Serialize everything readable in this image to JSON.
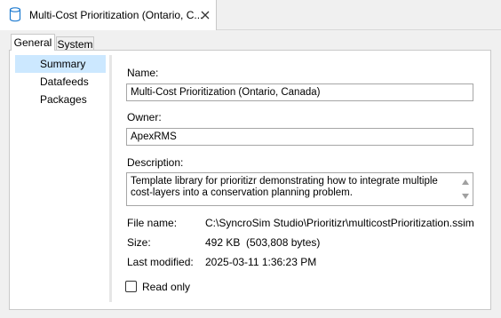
{
  "document_tab": {
    "title": "Multi-Cost Prioritization (Ontario, C...",
    "icon": "database-icon",
    "close_icon": "close-icon"
  },
  "tabs": [
    {
      "label": "General",
      "active": true
    },
    {
      "label": "System",
      "active": false
    }
  ],
  "nav": {
    "items": [
      {
        "label": "Summary",
        "selected": true
      },
      {
        "label": "Datafeeds",
        "selected": false
      },
      {
        "label": "Packages",
        "selected": false
      }
    ]
  },
  "form": {
    "name_label": "Name:",
    "name_value": "Multi-Cost Prioritization (Ontario, Canada)",
    "owner_label": "Owner:",
    "owner_value": "ApexRMS",
    "description_label": "Description:",
    "description_value": "Template library for prioritizr demonstrating how to integrate multiple cost-layers into a conservation planning problem."
  },
  "info": {
    "file_name_label": "File name:",
    "file_name_value": "C:\\SyncroSim Studio\\Prioritizr\\multicostPrioritization.ssim",
    "size_label": "Size:",
    "size_value": "492 KB  (503,808 bytes)",
    "modified_label": "Last modified:",
    "modified_value": "2025-03-11 1:36:23 PM"
  },
  "read_only": {
    "label": "Read only",
    "checked": false
  },
  "colors": {
    "selection": "#cce8ff",
    "panel_border": "#c9c9c9",
    "icon_blue": "#1e7bd0"
  }
}
